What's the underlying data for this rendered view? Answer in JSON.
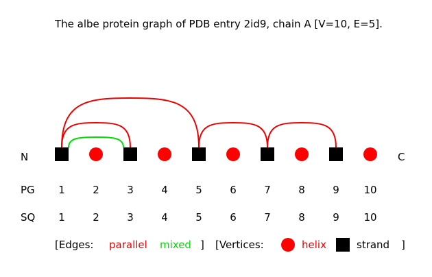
{
  "title": "The albe protein graph of PDB entry 2id9, chain A [V=10, E=5].",
  "terminals": {
    "n": "N",
    "c": "C"
  },
  "row_labels": {
    "pg": "PG",
    "sq": "SQ"
  },
  "vertices": [
    {
      "pg": "1",
      "sq": "1",
      "type": "strand"
    },
    {
      "pg": "2",
      "sq": "2",
      "type": "helix"
    },
    {
      "pg": "3",
      "sq": "3",
      "type": "strand"
    },
    {
      "pg": "4",
      "sq": "4",
      "type": "helix"
    },
    {
      "pg": "5",
      "sq": "5",
      "type": "strand"
    },
    {
      "pg": "6",
      "sq": "6",
      "type": "helix"
    },
    {
      "pg": "7",
      "sq": "7",
      "type": "strand"
    },
    {
      "pg": "8",
      "sq": "8",
      "type": "helix"
    },
    {
      "pg": "9",
      "sq": "9",
      "type": "strand"
    },
    {
      "pg": "10",
      "sq": "10",
      "type": "helix"
    }
  ],
  "edges": [
    {
      "from": 1,
      "to": 3,
      "type": "parallel"
    },
    {
      "from": 1,
      "to": 3,
      "type": "mixed"
    },
    {
      "from": 1,
      "to": 5,
      "type": "parallel"
    },
    {
      "from": 5,
      "to": 7,
      "type": "parallel"
    },
    {
      "from": 7,
      "to": 9,
      "type": "parallel"
    }
  ],
  "legend": {
    "edges_open": "[Edges:",
    "parallel": "parallel",
    "mixed": "mixed",
    "edges_close": "]",
    "vertices_open": "[Vertices:",
    "helix": "helix",
    "strand": "strand",
    "vertices_close": "]"
  },
  "colors": {
    "parallel": "#ee0000",
    "mixed": "#00dd00",
    "helix": "#ff0000",
    "strand": "#000000",
    "text": "#000000"
  }
}
